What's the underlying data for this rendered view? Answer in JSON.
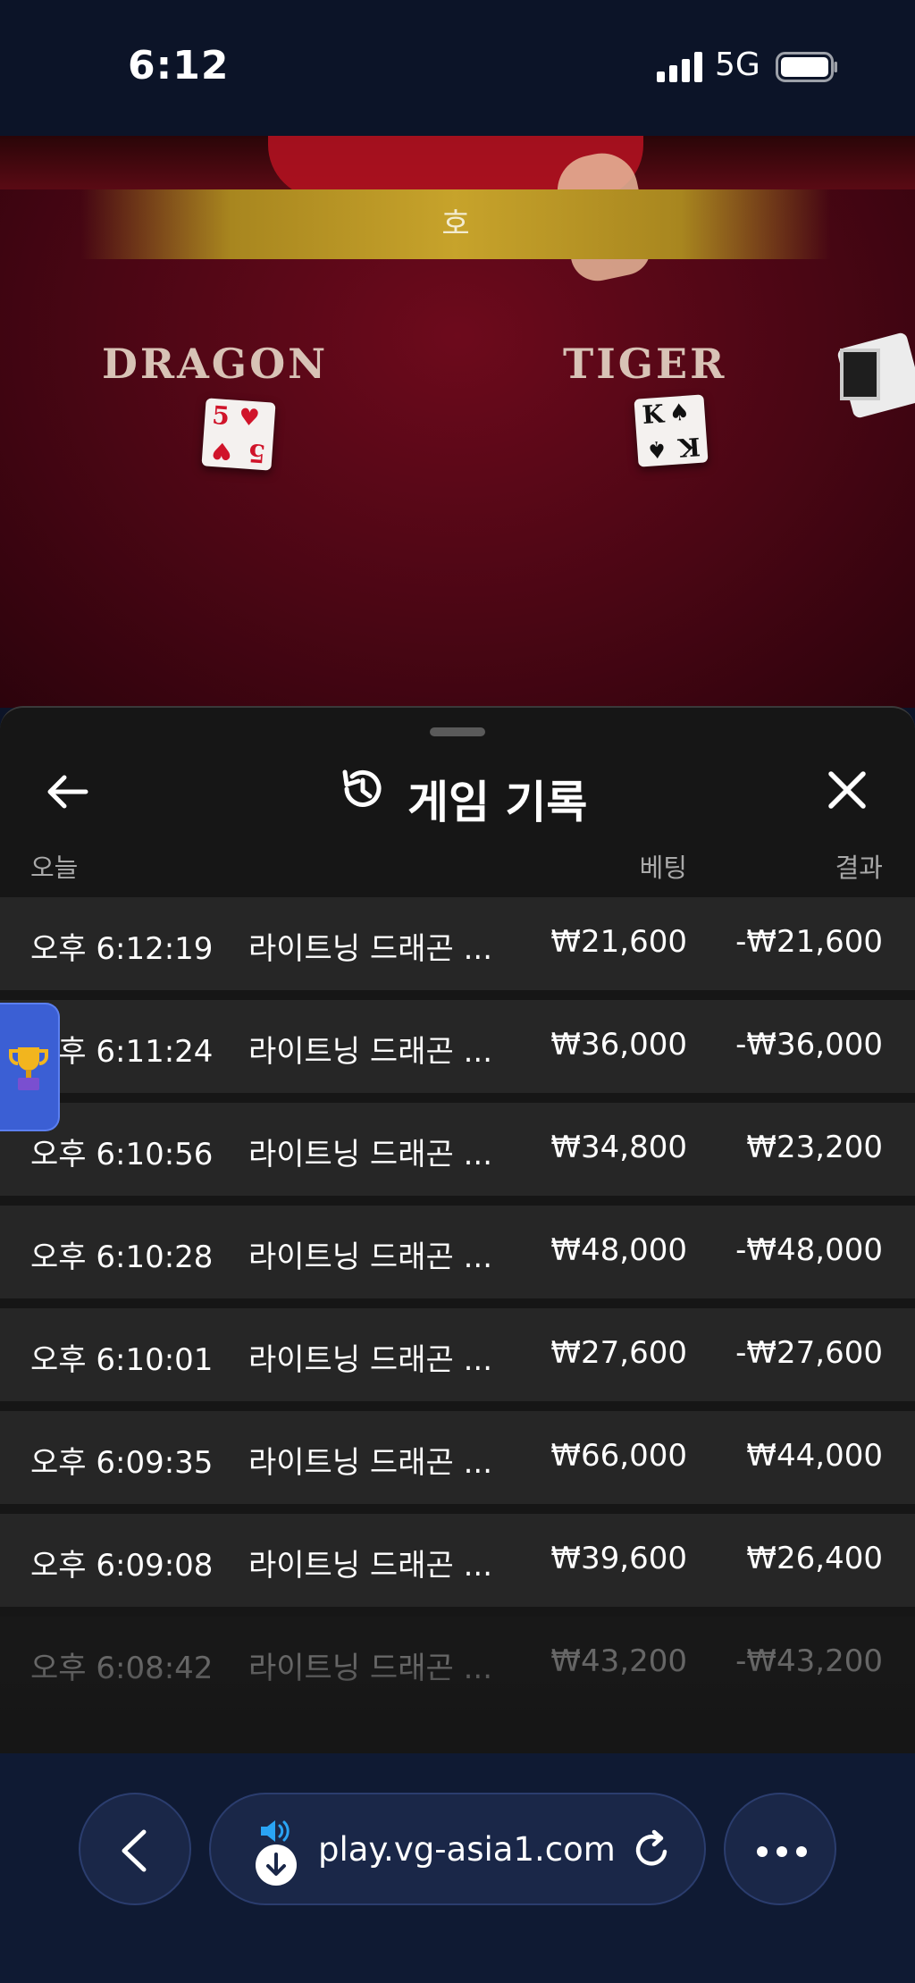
{
  "status_bar": {
    "time": "6:12",
    "network": "5G"
  },
  "game": {
    "banner": "호",
    "dragon_label": "DRAGON",
    "tiger_label": "TIGER",
    "dragon_card": {
      "rank": "5",
      "suit": "♥"
    },
    "tiger_card": {
      "rank": "K",
      "suit": "♠"
    }
  },
  "history": {
    "title": "게임 기록",
    "columns": {
      "today": "오늘",
      "bet": "베팅",
      "result": "결과"
    },
    "rows": [
      {
        "time": "오후 6:12:19",
        "game": "라이트닝 드래곤 ...",
        "bet": "₩21,600",
        "result": "-₩21,600"
      },
      {
        "time": "오후 6:11:24",
        "game": "라이트닝 드래곤 ...",
        "bet": "₩36,000",
        "result": "-₩36,000"
      },
      {
        "time": "오후 6:10:56",
        "game": "라이트닝 드래곤 ...",
        "bet": "₩34,800",
        "result": "₩23,200"
      },
      {
        "time": "오후 6:10:28",
        "game": "라이트닝 드래곤 ...",
        "bet": "₩48,000",
        "result": "-₩48,000"
      },
      {
        "time": "오후 6:10:01",
        "game": "라이트닝 드래곤 ...",
        "bet": "₩27,600",
        "result": "-₩27,600"
      },
      {
        "time": "오후 6:09:35",
        "game": "라이트닝 드래곤 ...",
        "bet": "₩66,000",
        "result": "₩44,000"
      },
      {
        "time": "오후 6:09:08",
        "game": "라이트닝 드래곤 ...",
        "bet": "₩39,600",
        "result": "₩26,400"
      },
      {
        "time": "오후 6:08:42",
        "game": "라이트닝 드래곤 ...",
        "bet": "₩43,200",
        "result": "-₩43,200"
      }
    ]
  },
  "browser": {
    "url": "play.vg-asia1.com"
  },
  "icons": {
    "back": "arrow-left-icon",
    "history": "history-icon",
    "close": "close-icon",
    "trophy": "trophy-icon",
    "nav_back": "chevron-left-icon",
    "speaker": "speaker-icon",
    "download": "download-icon",
    "reload": "reload-icon",
    "more": "more-icon"
  },
  "colors": {
    "background": "#0c1428",
    "sheet": "#161616",
    "row": "#262626",
    "accent": "#3b5fd4",
    "speaker": "#2aa4f4"
  }
}
